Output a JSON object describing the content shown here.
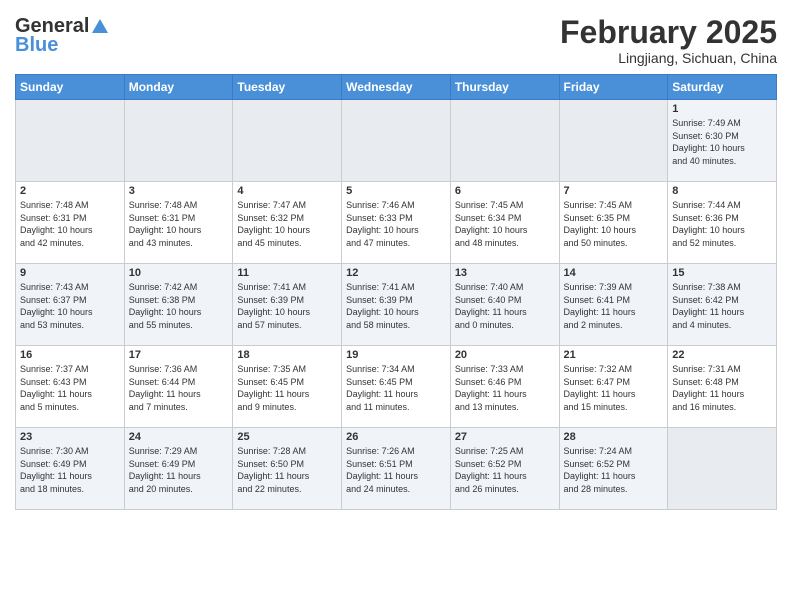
{
  "header": {
    "logo_general": "General",
    "logo_blue": "Blue",
    "month_title": "February 2025",
    "location": "Lingjiang, Sichuan, China"
  },
  "calendar": {
    "days_of_week": [
      "Sunday",
      "Monday",
      "Tuesday",
      "Wednesday",
      "Thursday",
      "Friday",
      "Saturday"
    ],
    "weeks": [
      [
        {
          "day": "",
          "info": ""
        },
        {
          "day": "",
          "info": ""
        },
        {
          "day": "",
          "info": ""
        },
        {
          "day": "",
          "info": ""
        },
        {
          "day": "",
          "info": ""
        },
        {
          "day": "",
          "info": ""
        },
        {
          "day": "1",
          "info": "Sunrise: 7:49 AM\nSunset: 6:30 PM\nDaylight: 10 hours\nand 40 minutes."
        }
      ],
      [
        {
          "day": "2",
          "info": "Sunrise: 7:48 AM\nSunset: 6:31 PM\nDaylight: 10 hours\nand 42 minutes."
        },
        {
          "day": "3",
          "info": "Sunrise: 7:48 AM\nSunset: 6:31 PM\nDaylight: 10 hours\nand 43 minutes."
        },
        {
          "day": "4",
          "info": "Sunrise: 7:47 AM\nSunset: 6:32 PM\nDaylight: 10 hours\nand 45 minutes."
        },
        {
          "day": "5",
          "info": "Sunrise: 7:46 AM\nSunset: 6:33 PM\nDaylight: 10 hours\nand 47 minutes."
        },
        {
          "day": "6",
          "info": "Sunrise: 7:45 AM\nSunset: 6:34 PM\nDaylight: 10 hours\nand 48 minutes."
        },
        {
          "day": "7",
          "info": "Sunrise: 7:45 AM\nSunset: 6:35 PM\nDaylight: 10 hours\nand 50 minutes."
        },
        {
          "day": "8",
          "info": "Sunrise: 7:44 AM\nSunset: 6:36 PM\nDaylight: 10 hours\nand 52 minutes."
        }
      ],
      [
        {
          "day": "9",
          "info": "Sunrise: 7:43 AM\nSunset: 6:37 PM\nDaylight: 10 hours\nand 53 minutes."
        },
        {
          "day": "10",
          "info": "Sunrise: 7:42 AM\nSunset: 6:38 PM\nDaylight: 10 hours\nand 55 minutes."
        },
        {
          "day": "11",
          "info": "Sunrise: 7:41 AM\nSunset: 6:39 PM\nDaylight: 10 hours\nand 57 minutes."
        },
        {
          "day": "12",
          "info": "Sunrise: 7:41 AM\nSunset: 6:39 PM\nDaylight: 10 hours\nand 58 minutes."
        },
        {
          "day": "13",
          "info": "Sunrise: 7:40 AM\nSunset: 6:40 PM\nDaylight: 11 hours\nand 0 minutes."
        },
        {
          "day": "14",
          "info": "Sunrise: 7:39 AM\nSunset: 6:41 PM\nDaylight: 11 hours\nand 2 minutes."
        },
        {
          "day": "15",
          "info": "Sunrise: 7:38 AM\nSunset: 6:42 PM\nDaylight: 11 hours\nand 4 minutes."
        }
      ],
      [
        {
          "day": "16",
          "info": "Sunrise: 7:37 AM\nSunset: 6:43 PM\nDaylight: 11 hours\nand 5 minutes."
        },
        {
          "day": "17",
          "info": "Sunrise: 7:36 AM\nSunset: 6:44 PM\nDaylight: 11 hours\nand 7 minutes."
        },
        {
          "day": "18",
          "info": "Sunrise: 7:35 AM\nSunset: 6:45 PM\nDaylight: 11 hours\nand 9 minutes."
        },
        {
          "day": "19",
          "info": "Sunrise: 7:34 AM\nSunset: 6:45 PM\nDaylight: 11 hours\nand 11 minutes."
        },
        {
          "day": "20",
          "info": "Sunrise: 7:33 AM\nSunset: 6:46 PM\nDaylight: 11 hours\nand 13 minutes."
        },
        {
          "day": "21",
          "info": "Sunrise: 7:32 AM\nSunset: 6:47 PM\nDaylight: 11 hours\nand 15 minutes."
        },
        {
          "day": "22",
          "info": "Sunrise: 7:31 AM\nSunset: 6:48 PM\nDaylight: 11 hours\nand 16 minutes."
        }
      ],
      [
        {
          "day": "23",
          "info": "Sunrise: 7:30 AM\nSunset: 6:49 PM\nDaylight: 11 hours\nand 18 minutes."
        },
        {
          "day": "24",
          "info": "Sunrise: 7:29 AM\nSunset: 6:49 PM\nDaylight: 11 hours\nand 20 minutes."
        },
        {
          "day": "25",
          "info": "Sunrise: 7:28 AM\nSunset: 6:50 PM\nDaylight: 11 hours\nand 22 minutes."
        },
        {
          "day": "26",
          "info": "Sunrise: 7:26 AM\nSunset: 6:51 PM\nDaylight: 11 hours\nand 24 minutes."
        },
        {
          "day": "27",
          "info": "Sunrise: 7:25 AM\nSunset: 6:52 PM\nDaylight: 11 hours\nand 26 minutes."
        },
        {
          "day": "28",
          "info": "Sunrise: 7:24 AM\nSunset: 6:52 PM\nDaylight: 11 hours\nand 28 minutes."
        },
        {
          "day": "",
          "info": ""
        }
      ]
    ]
  }
}
